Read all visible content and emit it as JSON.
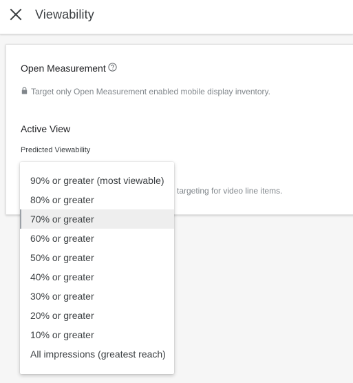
{
  "header": {
    "title": "Viewability",
    "close_icon": "close-icon"
  },
  "open_measurement": {
    "label": "Open Measurement",
    "help_icon": "help-circle-icon",
    "lock_icon": "lock-icon",
    "note": "Target only Open Measurement enabled mobile display inventory."
  },
  "active_view": {
    "label": "Active View",
    "predicted_label": "Predicted Viewability",
    "video_note": "targeting for video line items."
  },
  "dropdown": {
    "selected_index": 2,
    "options": [
      "90% or greater (most viewable)",
      "80% or greater",
      "70% or greater",
      "60% or greater",
      "50% or greater",
      "40% or greater",
      "30% or greater",
      "20% or greater",
      "10% or greater",
      "All impressions (greatest reach)"
    ]
  },
  "colors": {
    "text_primary": "#202124",
    "text_secondary": "#80868b",
    "selected_bg": "#eeeeee"
  }
}
